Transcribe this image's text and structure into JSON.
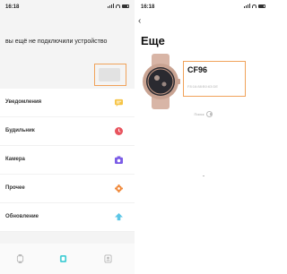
{
  "left": {
    "status_time": "16:18",
    "notice": "вы ещё не подключили устройство",
    "connect_button_label": "",
    "menu": [
      {
        "label": "Уведомления",
        "icon": "message-icon",
        "color": "#f6c445"
      },
      {
        "label": "Будильник",
        "icon": "clock-icon",
        "color": "#e8545e"
      },
      {
        "label": "Камера",
        "icon": "camera-icon",
        "color": "#7b5ce6"
      },
      {
        "label": "Прочее",
        "icon": "gear-icon",
        "color": "#f08a3c"
      },
      {
        "label": "Обновление",
        "icon": "upload-icon",
        "color": "#5cc6e6"
      }
    ],
    "tabs": [
      {
        "icon": "watch-icon",
        "color": "#b8b8b8"
      },
      {
        "icon": "device-icon",
        "color": "#4ccfd6"
      },
      {
        "icon": "profile-icon",
        "color": "#b8b8b8"
      }
    ]
  },
  "right": {
    "status_time": "16:18",
    "back_glyph": "‹",
    "title": "Еще",
    "device_name": "CF96",
    "mac": "F8:16:88:B0:63:DE",
    "search_label": "Поиск"
  },
  "colors": {
    "highlight": "#f0a25a",
    "accent": "#4ccfd6"
  }
}
